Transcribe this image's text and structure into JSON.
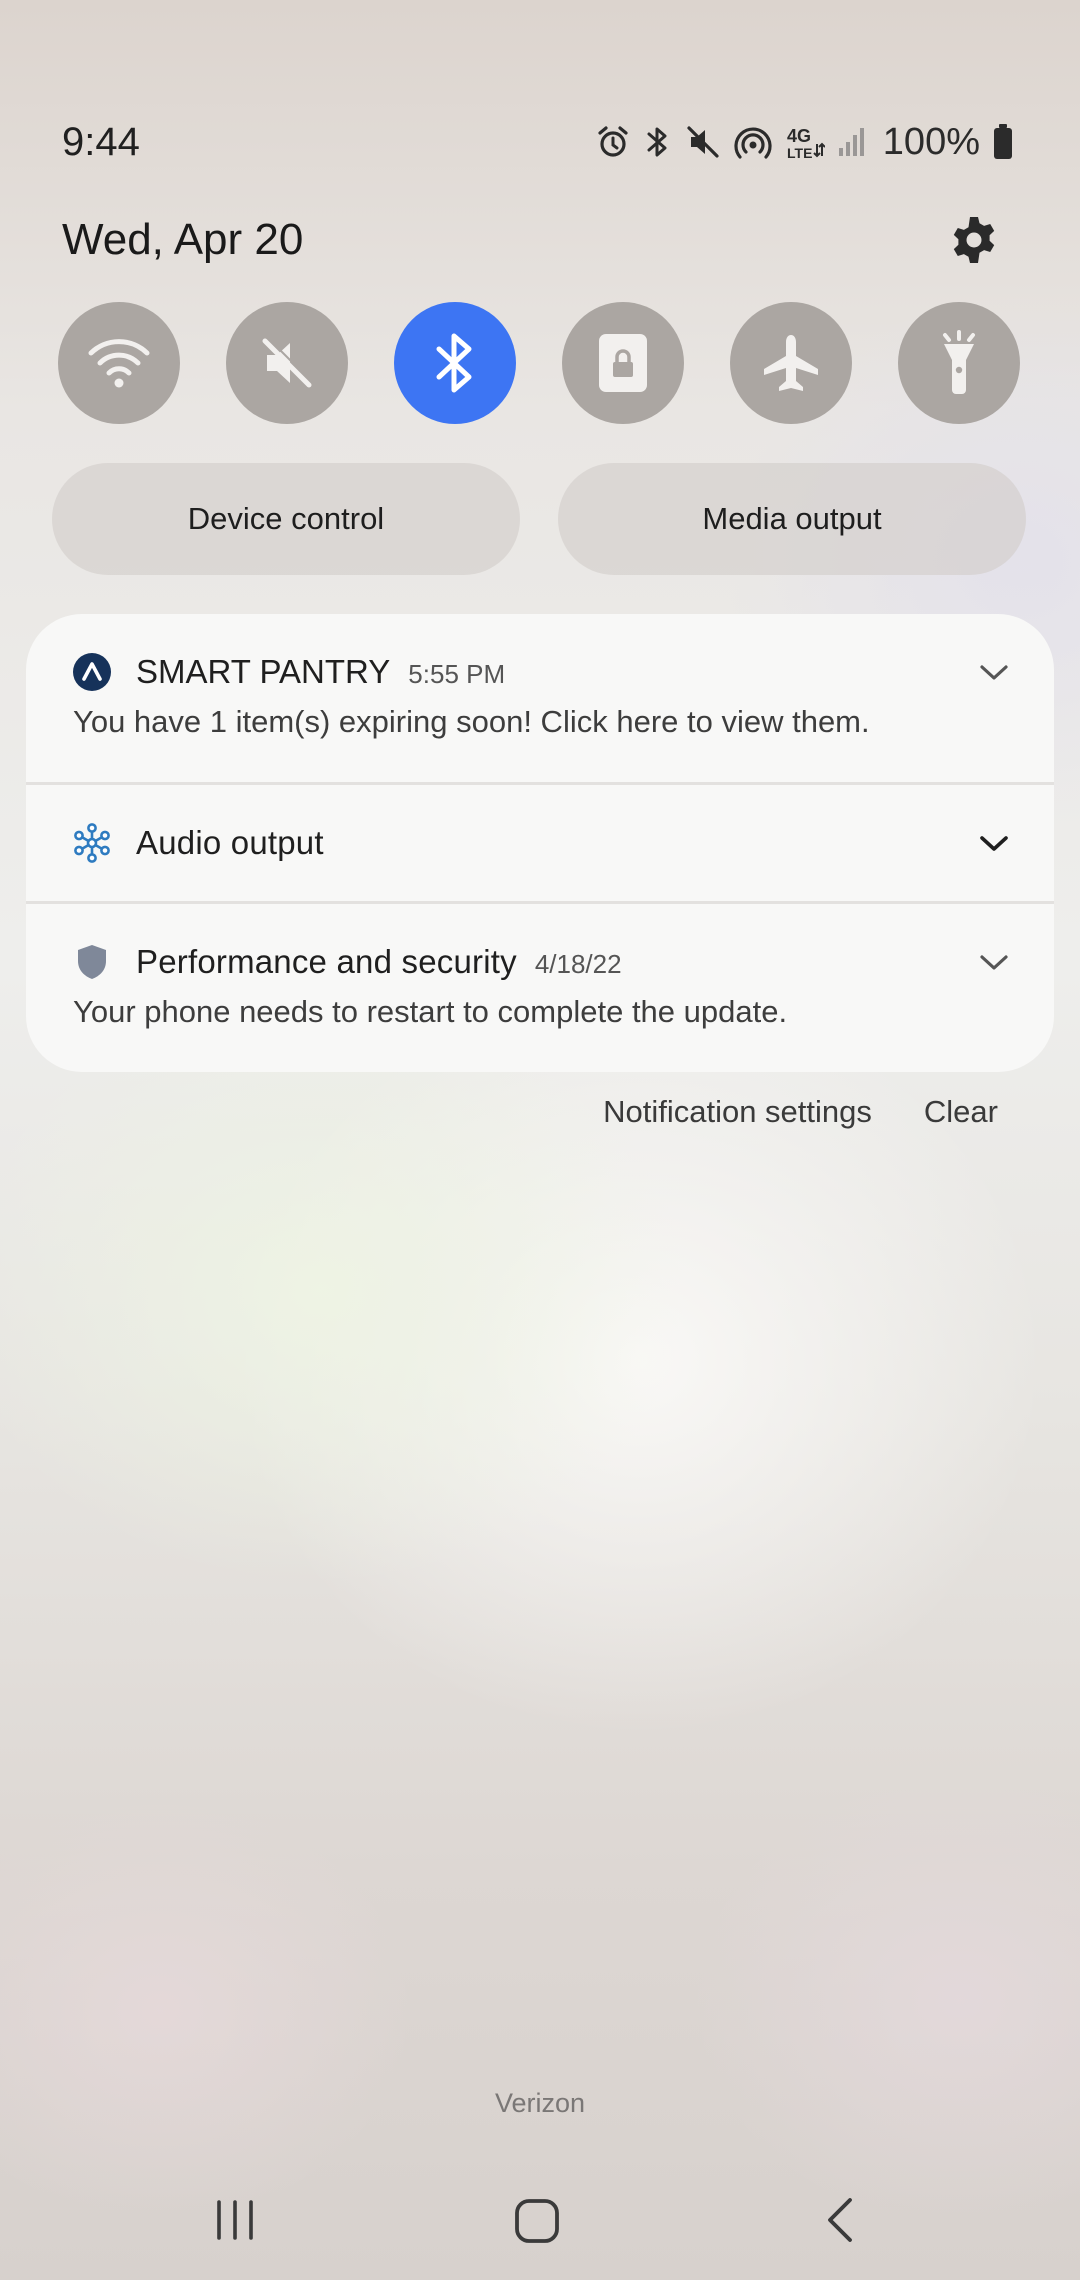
{
  "status_bar": {
    "time": "9:44",
    "battery_percent": "100%",
    "icons": [
      "alarm-icon",
      "bluetooth-icon",
      "mute-icon",
      "hotspot-icon",
      "lte-icon",
      "signal-icon",
      "battery-icon"
    ]
  },
  "header": {
    "date": "Wed, Apr 20",
    "settings_icon": "gear-icon"
  },
  "quick_settings": {
    "accent_color": "#3d75f3",
    "toggles": [
      {
        "name": "wifi",
        "icon": "wifi-icon",
        "active": false
      },
      {
        "name": "sound",
        "icon": "mute-icon",
        "active": false
      },
      {
        "name": "bluetooth",
        "icon": "bluetooth-icon",
        "active": true
      },
      {
        "name": "rotation-lock",
        "icon": "lock-icon",
        "active": false
      },
      {
        "name": "airplane",
        "icon": "airplane-icon",
        "active": false
      },
      {
        "name": "flashlight",
        "icon": "flashlight-icon",
        "active": false
      }
    ]
  },
  "controls": {
    "device_control": "Device control",
    "media_output": "Media output"
  },
  "notifications": [
    {
      "app": "SMART PANTRY",
      "time": "5:55 PM",
      "body": "You have 1 item(s) expiring soon! Click here to view them.",
      "icon": "smart-pantry-icon"
    },
    {
      "app": "Audio output",
      "icon": "audio-output-icon"
    },
    {
      "app": "Performance and security",
      "time": "4/18/22",
      "body": "Your phone needs to restart to complete the update.",
      "icon": "shield-icon"
    }
  ],
  "notification_actions": {
    "settings": "Notification settings",
    "clear": "Clear"
  },
  "carrier": "Verizon",
  "nav_bar": [
    "recents-icon",
    "home-icon",
    "back-icon"
  ]
}
